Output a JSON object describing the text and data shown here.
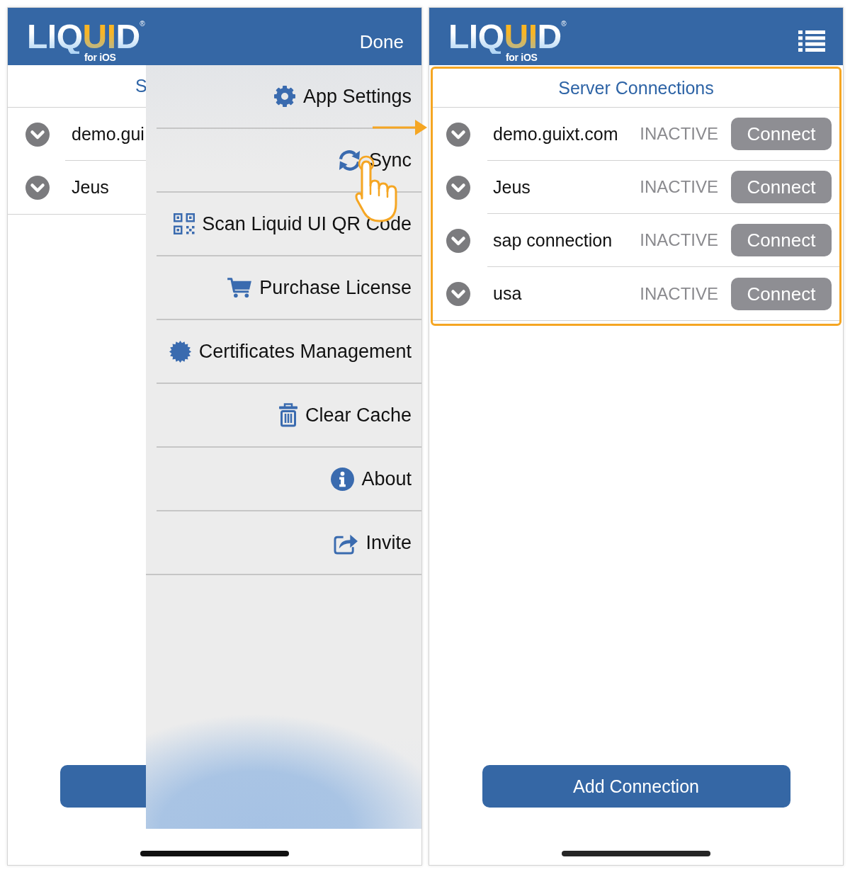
{
  "left_screen": {
    "header": {
      "logo": {
        "wordmark": "LIQUID",
        "registered": "®",
        "subtitle": "for iOS"
      },
      "done_button": "Done"
    },
    "title": "S",
    "connections": [
      {
        "name": "demo.gui"
      },
      {
        "name": "Jeus"
      }
    ],
    "menu": {
      "items": [
        {
          "kind": "settings",
          "label": "App Settings",
          "tapped": false
        },
        {
          "kind": "sync",
          "label": "Sync",
          "tapped": true
        },
        {
          "kind": "scan",
          "label": "Scan Liquid UI QR Code",
          "tapped": false
        },
        {
          "kind": "purchase",
          "label": "Purchase License",
          "tapped": false
        },
        {
          "kind": "certificates",
          "label": "Certificates Management",
          "tapped": false
        },
        {
          "kind": "clear",
          "label": "Clear Cache",
          "tapped": false
        },
        {
          "kind": "about",
          "label": "About",
          "tapped": false
        },
        {
          "kind": "invite",
          "label": "Invite",
          "tapped": false
        }
      ]
    }
  },
  "arrow_annotation": true,
  "right_screen": {
    "header": {
      "logo": {
        "wordmark": "LIQUID",
        "registered": "®",
        "subtitle": "for iOS"
      }
    },
    "connections_panel": {
      "highlighted": true,
      "title": "Server Connections",
      "connections": [
        {
          "name": "demo.guixt.com",
          "status": "INACTIVE",
          "action": "Connect"
        },
        {
          "name": "Jeus",
          "status": "INACTIVE",
          "action": "Connect"
        },
        {
          "name": "sap connection",
          "status": "INACTIVE",
          "action": "Connect"
        },
        {
          "name": "usa",
          "status": "INACTIVE",
          "action": "Connect"
        }
      ]
    },
    "add_button": "Add Connection"
  }
}
